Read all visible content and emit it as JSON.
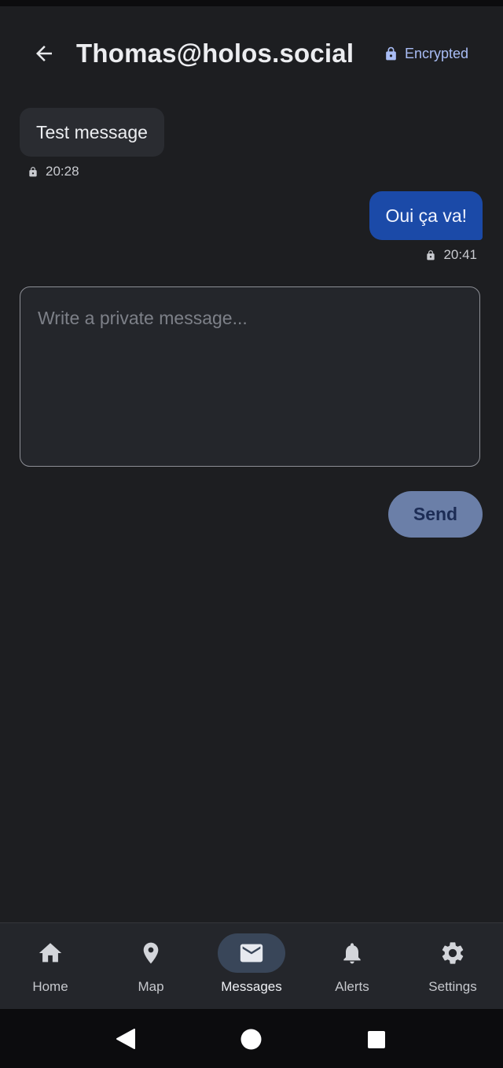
{
  "header": {
    "title": "Thomas@holos.social",
    "encrypted_label": "Encrypted"
  },
  "messages": [
    {
      "direction": "incoming",
      "text": "Test message",
      "time": "20:28"
    },
    {
      "direction": "outgoing",
      "text": "Oui ça va!",
      "time": "20:41"
    }
  ],
  "composer": {
    "placeholder": "Write a private message...",
    "value": "",
    "send_label": "Send"
  },
  "bottom_nav": {
    "active": "Messages",
    "items": [
      {
        "label": "Home",
        "icon": "home-icon"
      },
      {
        "label": "Map",
        "icon": "map-pin-icon"
      },
      {
        "label": "Messages",
        "icon": "mail-icon"
      },
      {
        "label": "Alerts",
        "icon": "bell-icon"
      },
      {
        "label": "Settings",
        "icon": "gear-icon"
      }
    ]
  },
  "colors": {
    "background": "#1d1e21",
    "outgoing_bubble": "#1b4aa8",
    "incoming_bubble": "#2a2c31",
    "accent": "#a9bdf5",
    "send_button": "#6b7fa8"
  }
}
